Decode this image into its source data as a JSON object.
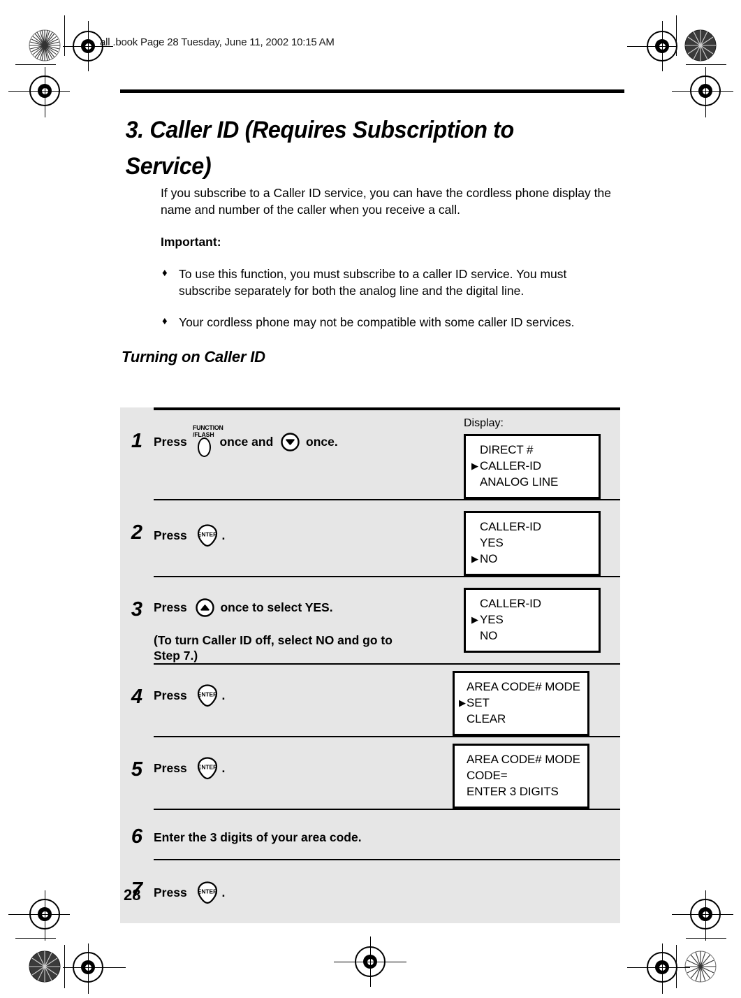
{
  "page": {
    "slug_prefix": "al",
    "slug_parts": [
      "al",
      "l",
      ".book",
      "Page",
      "28",
      "Tuesday,",
      "J",
      "une",
      "11,",
      "2002",
      "10:",
      "15",
      "AM"
    ],
    "slug_text": "all .book  Page 28  Tuesday, June 11, 2002  10:15 AM",
    "number": "28"
  },
  "chapter": {
    "title": "3.  Caller ID (Requires Subscription to Service)"
  },
  "intro": {
    "paragraph": "If you subscribe to a Caller ID service, you can have the cordless phone display the name and number of the caller when you receive a call.",
    "important_label": "Important:",
    "bullet_glyph": "♦",
    "bullets": [
      "To use this function, you must subscribe to a caller ID service. You must subscribe separately for both the analog line and the digital line.",
      "Your cordless phone may not be compatible with some caller ID services."
    ]
  },
  "section": {
    "title": "Turning on Caller ID",
    "display_label": "Display:"
  },
  "keys": {
    "function_flash_line1": "FUNCTION",
    "function_flash_line2": "/FLASH",
    "enter_label": "ENTER",
    "cursor_glyph": "▶"
  },
  "steps": [
    {
      "number": "1",
      "text_before_key1": "Press",
      "key1": "function-flash",
      "text_mid": "once and",
      "key2": "arrow-down",
      "text_after": "once.",
      "note": "",
      "display": {
        "lines": [
          {
            "cursor": false,
            "text": "DIRECT #"
          },
          {
            "cursor": true,
            "text": "CALLER-ID"
          },
          {
            "cursor": false,
            "text": "ANALOG LINE"
          }
        ]
      }
    },
    {
      "number": "2",
      "text_before_key1": "Press",
      "key1": "enter",
      "text_mid": "",
      "key2": "",
      "text_after": ".",
      "note": "",
      "display": {
        "lines": [
          {
            "cursor": false,
            "text": "CALLER-ID"
          },
          {
            "cursor": false,
            "text": "YES"
          },
          {
            "cursor": true,
            "text": "NO"
          }
        ]
      }
    },
    {
      "number": "3",
      "text_before_key1": "Press",
      "key1": "arrow-up",
      "text_mid": "",
      "key2": "",
      "text_after": "once to select YES.",
      "note": "(To turn Caller ID off, select NO and go to Step 7.)",
      "display": {
        "lines": [
          {
            "cursor": false,
            "text": "CALLER-ID"
          },
          {
            "cursor": true,
            "text": "YES"
          },
          {
            "cursor": false,
            "text": "NO"
          }
        ]
      }
    },
    {
      "number": "4",
      "text_before_key1": "Press",
      "key1": "enter",
      "text_mid": "",
      "key2": "",
      "text_after": ".",
      "note": "",
      "display": {
        "lines": [
          {
            "cursor": false,
            "text": "AREA CODE# MODE"
          },
          {
            "cursor": true,
            "text": "SET"
          },
          {
            "cursor": false,
            "text": "CLEAR"
          }
        ]
      }
    },
    {
      "number": "5",
      "text_before_key1": "Press",
      "key1": "enter",
      "text_mid": "",
      "key2": "",
      "text_after": ".",
      "note": "",
      "display": {
        "lines": [
          {
            "cursor": false,
            "text": "AREA CODE# MODE"
          },
          {
            "cursor": false,
            "text": "CODE="
          },
          {
            "cursor": false,
            "text": "ENTER 3 DIGITS"
          }
        ]
      }
    },
    {
      "number": "6",
      "text_before_key1": "Enter the 3 digits of your area code.",
      "key1": "",
      "text_mid": "",
      "key2": "",
      "text_after": "",
      "note": "",
      "display": null
    },
    {
      "number": "7",
      "text_before_key1": "Press",
      "key1": "enter",
      "text_mid": "",
      "key2": "",
      "text_after": ".",
      "note": "",
      "display": null
    }
  ],
  "colors": {
    "table_bg": "#e6e6e6",
    "rule": "#000000",
    "lcd_bg": "#ffffff"
  }
}
